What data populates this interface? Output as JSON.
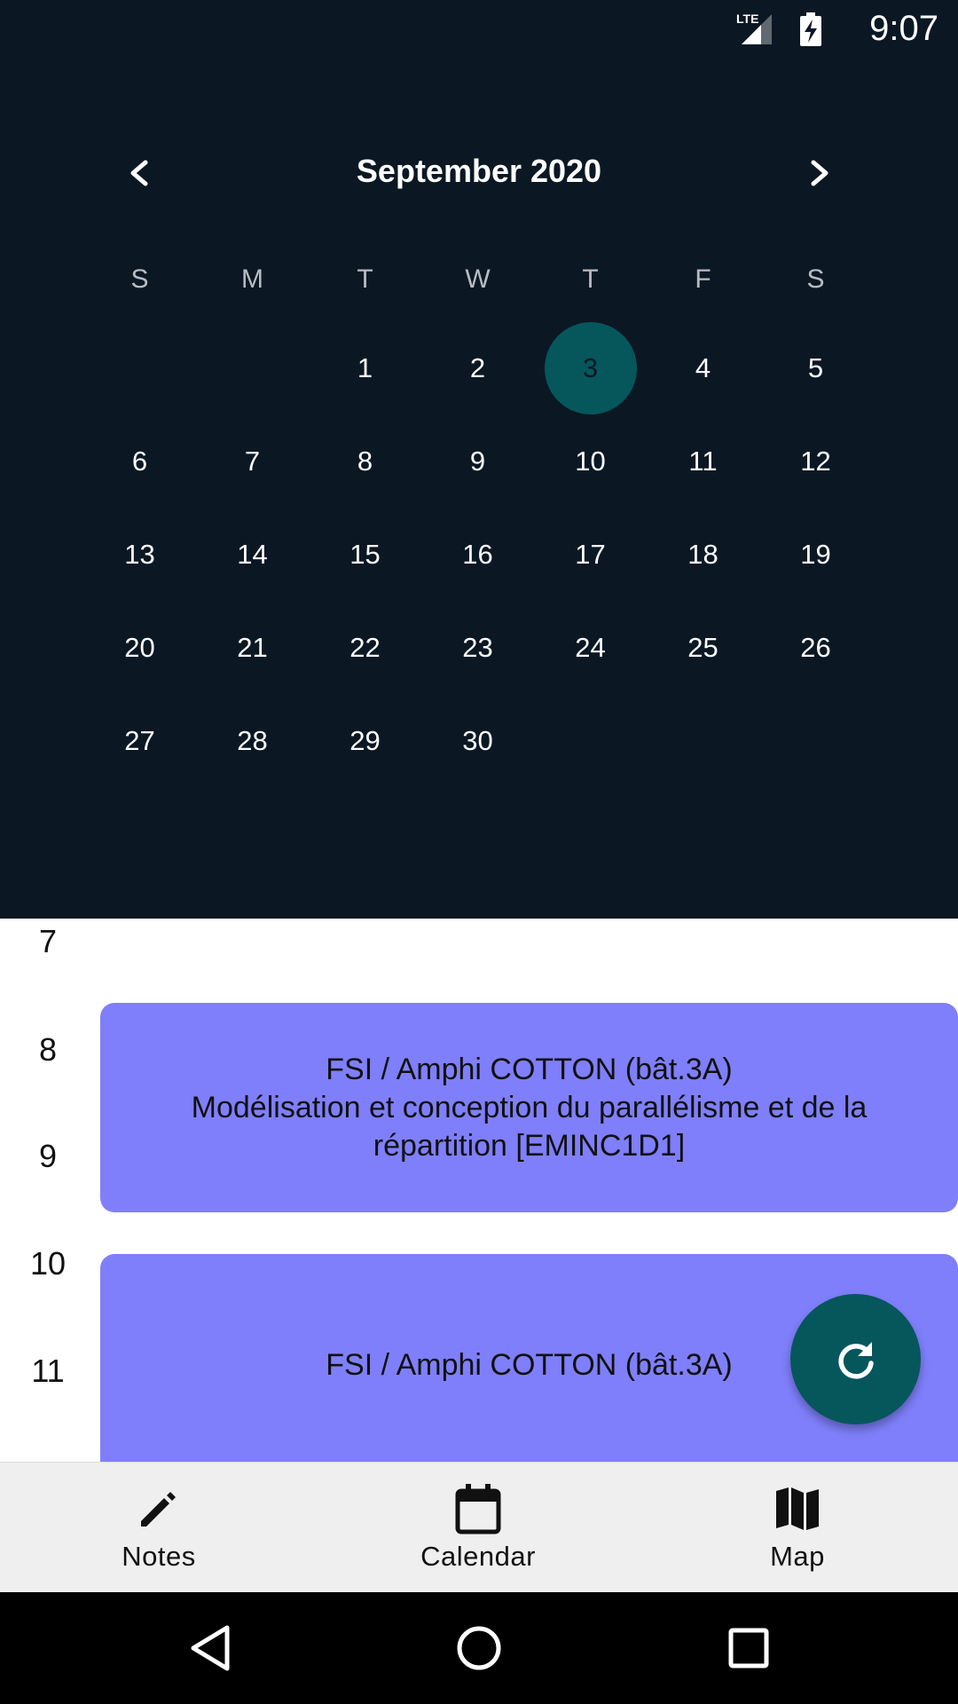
{
  "status_bar": {
    "time": "9:07",
    "network": "LTE",
    "icons": [
      "lte-signal-icon",
      "battery-charging-icon"
    ]
  },
  "calendar": {
    "month_label": "September 2020",
    "prev_icon": "chevron-left-icon",
    "next_icon": "chevron-right-icon",
    "weekdays": [
      "S",
      "M",
      "T",
      "W",
      "T",
      "F",
      "S"
    ],
    "days": [
      "",
      "",
      "1",
      "2",
      "3",
      "4",
      "5",
      "6",
      "7",
      "8",
      "9",
      "10",
      "11",
      "12",
      "13",
      "14",
      "15",
      "16",
      "17",
      "18",
      "19",
      "20",
      "21",
      "22",
      "23",
      "24",
      "25",
      "26",
      "27",
      "28",
      "29",
      "30"
    ],
    "selected_day": "3"
  },
  "schedule": {
    "hours": [
      "7",
      "8",
      "9",
      "10",
      "11"
    ],
    "events": [
      {
        "lines": [
          "FSI / Amphi COTTON (bât.3A)",
          "Modélisation et conception du parallélisme et de la",
          "répartition [EMINC1D1]"
        ]
      },
      {
        "lines": [
          "FSI / Amphi COTTON (bât.3A)"
        ]
      }
    ],
    "refresh_icon": "refresh-icon"
  },
  "bottom_nav": {
    "items": [
      {
        "label": "Notes",
        "icon": "pencil-icon"
      },
      {
        "label": "Calendar",
        "icon": "calendar-icon"
      },
      {
        "label": "Map",
        "icon": "map-icon"
      }
    ]
  },
  "system_nav": {
    "icons": [
      "back-icon",
      "home-icon",
      "recents-icon"
    ]
  },
  "colors": {
    "header_bg": "#0b1824",
    "selected_day": "#05575c",
    "event_bg": "#7f7ffb",
    "fab_bg": "#05575c",
    "bottom_nav_bg": "#efefef"
  }
}
